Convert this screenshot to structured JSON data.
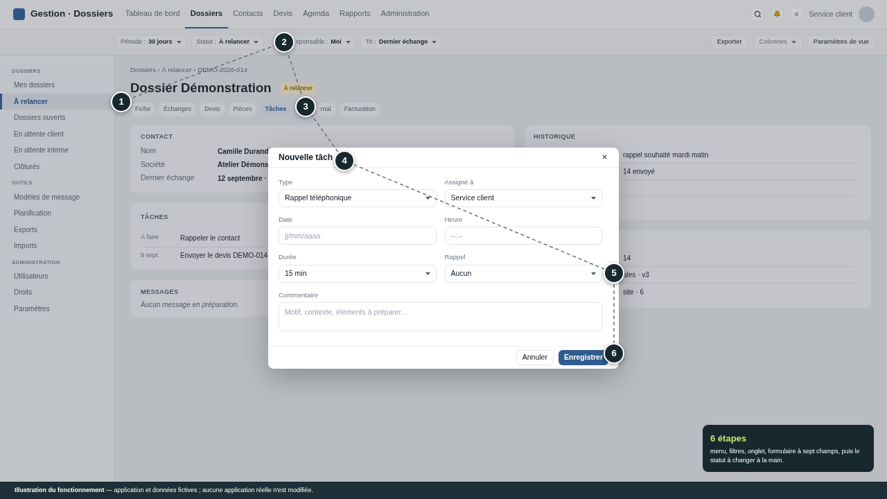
{
  "app": {
    "title": "Gestion · Dossiers"
  },
  "nav": [
    {
      "label": "Tableau de bord",
      "selected": false
    },
    {
      "label": "Dossiers",
      "selected": true
    },
    {
      "label": "Contacts",
      "selected": false
    },
    {
      "label": "Devis",
      "selected": false
    },
    {
      "label": "Agenda",
      "selected": false
    },
    {
      "label": "Rapports",
      "selected": false
    },
    {
      "label": "Administration",
      "selected": false
    }
  ],
  "user": {
    "name": "Service client"
  },
  "filters": [
    {
      "label": "Période :",
      "value": "30 jours"
    },
    {
      "label": "Statut :",
      "value": "À relancer"
    },
    {
      "label": "sponsable :",
      "value": "Moi"
    },
    {
      "label": "Tri :",
      "value": "Dernier échange"
    }
  ],
  "view_actions": [
    {
      "label": "Exporter",
      "kind": "button"
    },
    {
      "label": "Colonnes",
      "kind": "dropdown"
    },
    {
      "label": "Paramètres de vue",
      "kind": "button"
    }
  ],
  "sidebar": [
    {
      "title": "DOSSIERS",
      "items": [
        {
          "label": "Mes dossiers",
          "selected": false
        },
        {
          "label": "À relancer",
          "selected": true
        },
        {
          "label": "Dossiers ouverts",
          "selected": false
        },
        {
          "label": "En attente client",
          "selected": false
        },
        {
          "label": "En attente interne",
          "selected": false
        },
        {
          "label": "Clôturés",
          "selected": false
        }
      ]
    },
    {
      "title": "OUTILS",
      "items": [
        {
          "label": "Modèles de message",
          "selected": false
        },
        {
          "label": "Planification",
          "selected": false
        },
        {
          "label": "Exports",
          "selected": false
        },
        {
          "label": "Imports",
          "selected": false
        }
      ]
    },
    {
      "title": "ADMINISTRATION",
      "items": [
        {
          "label": "Utilisateurs",
          "selected": false
        },
        {
          "label": "Droits",
          "selected": false
        },
        {
          "label": "Paramètres",
          "selected": false
        }
      ]
    }
  ],
  "breadcrumb": "Dossiers › À relancer › DEMO-2026-014",
  "page_title": "Dossier Démonstration",
  "status_badge": "À relancer",
  "tabs": [
    {
      "label": "Fiche",
      "selected": false
    },
    {
      "label": "Échanges",
      "selected": false
    },
    {
      "label": "Devis",
      "selected": false
    },
    {
      "label": "Pièces",
      "selected": false
    },
    {
      "label": "Tâches",
      "selected": true
    },
    {
      "label": "rnal",
      "selected": false
    },
    {
      "label": "Facturation",
      "selected": false
    }
  ],
  "contact": {
    "title": "CONTACT",
    "rows": [
      {
        "label": "Nom",
        "value": "Camille Durand"
      },
      {
        "label": "Société",
        "value": "Atelier Démons"
      },
      {
        "label": "Dernier échange",
        "value": "12 septembre ·"
      }
    ]
  },
  "tasks": {
    "title": "TÂCHES",
    "rows": [
      {
        "date": "À faire",
        "label": "Rappeler le contact"
      },
      {
        "date": "9 sept.",
        "label": "Envoyer le devis DEMO-014"
      }
    ]
  },
  "messages": {
    "title": "MESSAGES",
    "empty": "Aucun message en préparation."
  },
  "history": {
    "title": "HISTORIQUE",
    "rows": [
      "rappel souhaité mardi matin",
      "14 envoyé"
    ]
  },
  "side_card": {
    "rows": [
      "14",
      "ales · v3",
      "site · 6"
    ]
  },
  "dialog": {
    "title": "Nouvelle tâch",
    "fields": [
      {
        "label": "Type",
        "kind": "select",
        "value": "Rappel téléphonique"
      },
      {
        "label": "Assigné à",
        "kind": "select",
        "value": "Service client"
      },
      {
        "label": "Date",
        "kind": "input",
        "placeholder": "jj/mm/aaaa"
      },
      {
        "label": "Heure",
        "kind": "input",
        "placeholder": "--:--"
      },
      {
        "label": "Durée",
        "kind": "select",
        "value": "15 min"
      },
      {
        "label": "Rappel",
        "kind": "select",
        "value": "Aucun"
      },
      {
        "label": "Commentaire",
        "kind": "textarea",
        "placeholder": "Motif, contexte, éléments à préparer…"
      }
    ],
    "cancel": "Annuler",
    "save": "Enregistrer"
  },
  "steps": [
    "1",
    "2",
    "3",
    "4",
    "5",
    "6"
  ],
  "callout": {
    "title": "6 étapes",
    "text": "menu, filtres, onglet, formulaire à sept champs, puis le statut à changer à la main."
  },
  "footer": "**Illustration du fonctionnement** — application et données fictives ; aucune application réelle n'est modifiée."
}
